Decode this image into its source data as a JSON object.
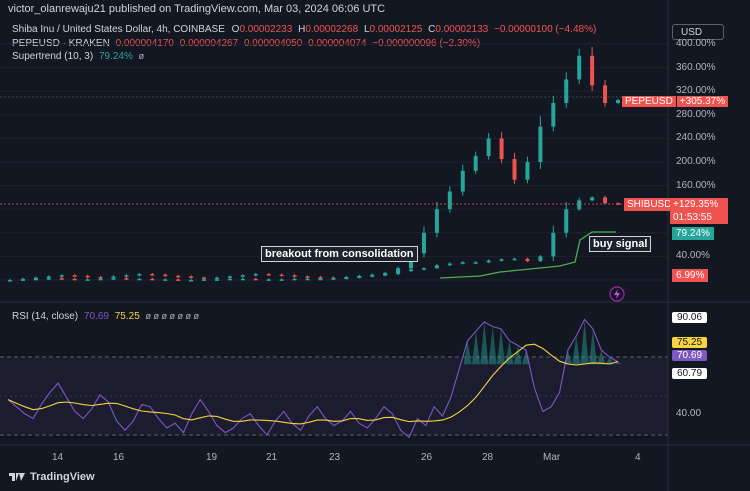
{
  "header": {
    "publisher": "victor_olanrewaju21 published on TradingView.com, Mar 03, 2024 06:06 UTC"
  },
  "legend": {
    "main": {
      "title": "Shiba Inu / United States Dollar, 4h, COINBASE",
      "o_label": "O",
      "o": "0.00002233",
      "h_label": "H",
      "h": "0.00002268",
      "l_label": "L",
      "l": "0.00002125",
      "c_label": "C",
      "c": "0.00002133",
      "chg": "−0.00000100 (−4.48%)"
    },
    "pepe": {
      "title": "PEPEUSD · KRAKEN",
      "o": "0.000004170",
      "h": "0.000004267",
      "l": "0.000004050",
      "c": "0.000004074",
      "chg": "−0.000000096 (−2.30%)"
    },
    "supertrend": {
      "title": "Supertrend (10, 3)",
      "value": "79.24%"
    }
  },
  "currency_button": "USD",
  "price_axis_labels": [
    "400.00%",
    "360.00%",
    "320.00%",
    "280.00%",
    "240.00%",
    "200.00%",
    "160.00%",
    "120.00%",
    "80.00%",
    "40.00%",
    "0.00%"
  ],
  "badges": {
    "pepe_name": "PEPEUSD",
    "pepe_value": "+305.37%",
    "shib_name": "SHIBUSD",
    "shib_value": "+129.35%",
    "countdown": "01:53:55",
    "supertrend_value": "79.24%",
    "low_value": "6.99%"
  },
  "annotations": {
    "breakout": "breakout from consolidation",
    "buy": "buy signal"
  },
  "rsi": {
    "title": "RSI (14, close)",
    "value": "70.69",
    "ma_value": "75.25",
    "axis_labels": {
      "upper": "90.06",
      "ma": "75.25",
      "current": "70.69",
      "mid": "60.79",
      "lower": "40.00"
    }
  },
  "x_axis": {
    "labels": [
      "14",
      "16",
      "19",
      "21",
      "23",
      "26",
      "28",
      "Mar",
      "4"
    ]
  },
  "footer": {
    "brand": "TradingView"
  },
  "colors": {
    "up": "#26a69a",
    "down": "#ef5350",
    "supertrend": "#4caf50",
    "rsi": "#7e57c2",
    "rsi_ma": "#f7d33f",
    "pepe": "#b2b5be"
  },
  "chart_data": {
    "type": "candlestick",
    "title": "Shiba Inu / United States Dollar, 4h, COINBASE",
    "y_unit": "percent change",
    "ylim": [
      0,
      400
    ],
    "x_ticks": [
      "14",
      "16",
      "19",
      "21",
      "23",
      "26",
      "28",
      "Mar",
      "4"
    ],
    "series": [
      {
        "name": "PEPEUSD",
        "last_value": 305.37,
        "candles_close": [
          0,
          2,
          4,
          6,
          8,
          7,
          5,
          4,
          6,
          8,
          10,
          9,
          7,
          6,
          4,
          3,
          4,
          6,
          8,
          10,
          9,
          8,
          6,
          5,
          4,
          3,
          5,
          7,
          9,
          10,
          20,
          45,
          80,
          120,
          150,
          185,
          210,
          240,
          205,
          170,
          200,
          260,
          300,
          340,
          380,
          330,
          300,
          305
        ]
      },
      {
        "name": "SHIBUSD",
        "last_value": 129.35,
        "candles_close": [
          0,
          1,
          2,
          3,
          2,
          1,
          1,
          2,
          3,
          2,
          2,
          1,
          1,
          0,
          0,
          1,
          1,
          2,
          2,
          1,
          1,
          1,
          2,
          2,
          2,
          3,
          4,
          6,
          8,
          12,
          15,
          18,
          20,
          25,
          28,
          30,
          30,
          33,
          35,
          36,
          32,
          40,
          80,
          120,
          135,
          140,
          130,
          129
        ]
      },
      {
        "name": "Supertrend (10, 3)",
        "last_value": 79.24
      },
      {
        "name": "RSI (14, close)",
        "last_value": 70.69,
        "values": [
          55,
          52,
          49,
          47,
          53,
          58,
          62,
          56,
          50,
          47,
          51,
          57,
          54,
          46,
          42,
          46,
          53,
          52,
          47,
          43,
          45,
          41,
          49,
          55,
          50,
          44,
          41,
          43,
          47,
          49,
          44,
          40,
          46,
          50,
          45,
          42,
          48,
          52,
          47,
          44,
          46,
          50,
          45,
          43,
          47,
          52,
          49,
          42,
          39,
          47,
          44,
          52,
          48,
          56,
          68,
          80,
          84,
          88,
          86,
          85,
          80,
          78,
          76,
          60,
          50,
          52,
          58,
          76,
          82,
          89,
          85,
          76,
          73,
          71
        ]
      }
    ]
  }
}
